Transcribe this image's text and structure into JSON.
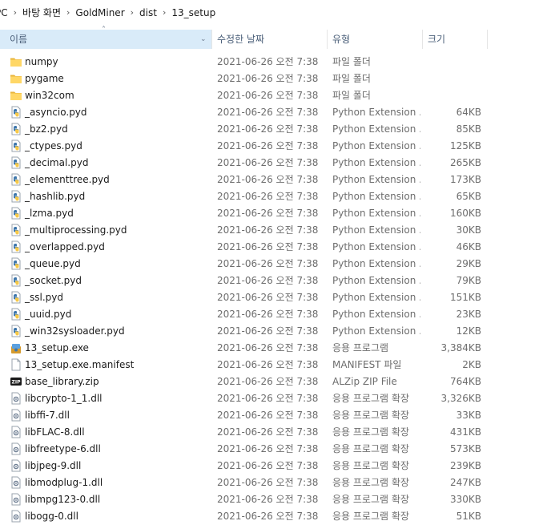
{
  "breadcrumb": [
    "PC",
    "바탕 화면",
    "GoldMiner",
    "dist",
    "13_setup"
  ],
  "columns": {
    "name": "이름",
    "date": "수정한 날짜",
    "type": "유형",
    "size": "크기"
  },
  "files": [
    {
      "name": "numpy",
      "date": "2021-06-26 오전 7:38",
      "type": "파일 폴더",
      "size": "",
      "icon": "folder"
    },
    {
      "name": "pygame",
      "date": "2021-06-26 오전 7:38",
      "type": "파일 폴더",
      "size": "",
      "icon": "folder"
    },
    {
      "name": "win32com",
      "date": "2021-06-26 오전 7:38",
      "type": "파일 폴더",
      "size": "",
      "icon": "folder"
    },
    {
      "name": "_asyncio.pyd",
      "date": "2021-06-26 오전 7:38",
      "type": "Python Extension ...",
      "size": "64KB",
      "icon": "python"
    },
    {
      "name": "_bz2.pyd",
      "date": "2021-06-26 오전 7:38",
      "type": "Python Extension ...",
      "size": "85KB",
      "icon": "python"
    },
    {
      "name": "_ctypes.pyd",
      "date": "2021-06-26 오전 7:38",
      "type": "Python Extension ...",
      "size": "125KB",
      "icon": "python"
    },
    {
      "name": "_decimal.pyd",
      "date": "2021-06-26 오전 7:38",
      "type": "Python Extension ...",
      "size": "265KB",
      "icon": "python"
    },
    {
      "name": "_elementtree.pyd",
      "date": "2021-06-26 오전 7:38",
      "type": "Python Extension ...",
      "size": "173KB",
      "icon": "python"
    },
    {
      "name": "_hashlib.pyd",
      "date": "2021-06-26 오전 7:38",
      "type": "Python Extension ...",
      "size": "65KB",
      "icon": "python"
    },
    {
      "name": "_lzma.pyd",
      "date": "2021-06-26 오전 7:38",
      "type": "Python Extension ...",
      "size": "160KB",
      "icon": "python"
    },
    {
      "name": "_multiprocessing.pyd",
      "date": "2021-06-26 오전 7:38",
      "type": "Python Extension ...",
      "size": "30KB",
      "icon": "python"
    },
    {
      "name": "_overlapped.pyd",
      "date": "2021-06-26 오전 7:38",
      "type": "Python Extension ...",
      "size": "46KB",
      "icon": "python"
    },
    {
      "name": "_queue.pyd",
      "date": "2021-06-26 오전 7:38",
      "type": "Python Extension ...",
      "size": "29KB",
      "icon": "python"
    },
    {
      "name": "_socket.pyd",
      "date": "2021-06-26 오전 7:38",
      "type": "Python Extension ...",
      "size": "79KB",
      "icon": "python"
    },
    {
      "name": "_ssl.pyd",
      "date": "2021-06-26 오전 7:38",
      "type": "Python Extension ...",
      "size": "151KB",
      "icon": "python"
    },
    {
      "name": "_uuid.pyd",
      "date": "2021-06-26 오전 7:38",
      "type": "Python Extension ...",
      "size": "23KB",
      "icon": "python"
    },
    {
      "name": "_win32sysloader.pyd",
      "date": "2021-06-26 오전 7:38",
      "type": "Python Extension ...",
      "size": "12KB",
      "icon": "python"
    },
    {
      "name": "13_setup.exe",
      "date": "2021-06-26 오전 7:38",
      "type": "응용 프로그램",
      "size": "3,384KB",
      "icon": "exe"
    },
    {
      "name": "13_setup.exe.manifest",
      "date": "2021-06-26 오전 7:38",
      "type": "MANIFEST 파일",
      "size": "2KB",
      "icon": "file"
    },
    {
      "name": "base_library.zip",
      "date": "2021-06-26 오전 7:38",
      "type": "ALZip ZIP File",
      "size": "764KB",
      "icon": "zip"
    },
    {
      "name": "libcrypto-1_1.dll",
      "date": "2021-06-26 오전 7:38",
      "type": "응용 프로그램 확장",
      "size": "3,326KB",
      "icon": "dll"
    },
    {
      "name": "libffi-7.dll",
      "date": "2021-06-26 오전 7:38",
      "type": "응용 프로그램 확장",
      "size": "33KB",
      "icon": "dll"
    },
    {
      "name": "libFLAC-8.dll",
      "date": "2021-06-26 오전 7:38",
      "type": "응용 프로그램 확장",
      "size": "431KB",
      "icon": "dll"
    },
    {
      "name": "libfreetype-6.dll",
      "date": "2021-06-26 오전 7:38",
      "type": "응용 프로그램 확장",
      "size": "573KB",
      "icon": "dll"
    },
    {
      "name": "libjpeg-9.dll",
      "date": "2021-06-26 오전 7:38",
      "type": "응용 프로그램 확장",
      "size": "239KB",
      "icon": "dll"
    },
    {
      "name": "libmodplug-1.dll",
      "date": "2021-06-26 오전 7:38",
      "type": "응용 프로그램 확장",
      "size": "247KB",
      "icon": "dll"
    },
    {
      "name": "libmpg123-0.dll",
      "date": "2021-06-26 오전 7:38",
      "type": "응용 프로그램 확장",
      "size": "330KB",
      "icon": "dll"
    },
    {
      "name": "libogg-0.dll",
      "date": "2021-06-26 오전 7:38",
      "type": "응용 프로그램 확장",
      "size": "51KB",
      "icon": "dll"
    }
  ]
}
